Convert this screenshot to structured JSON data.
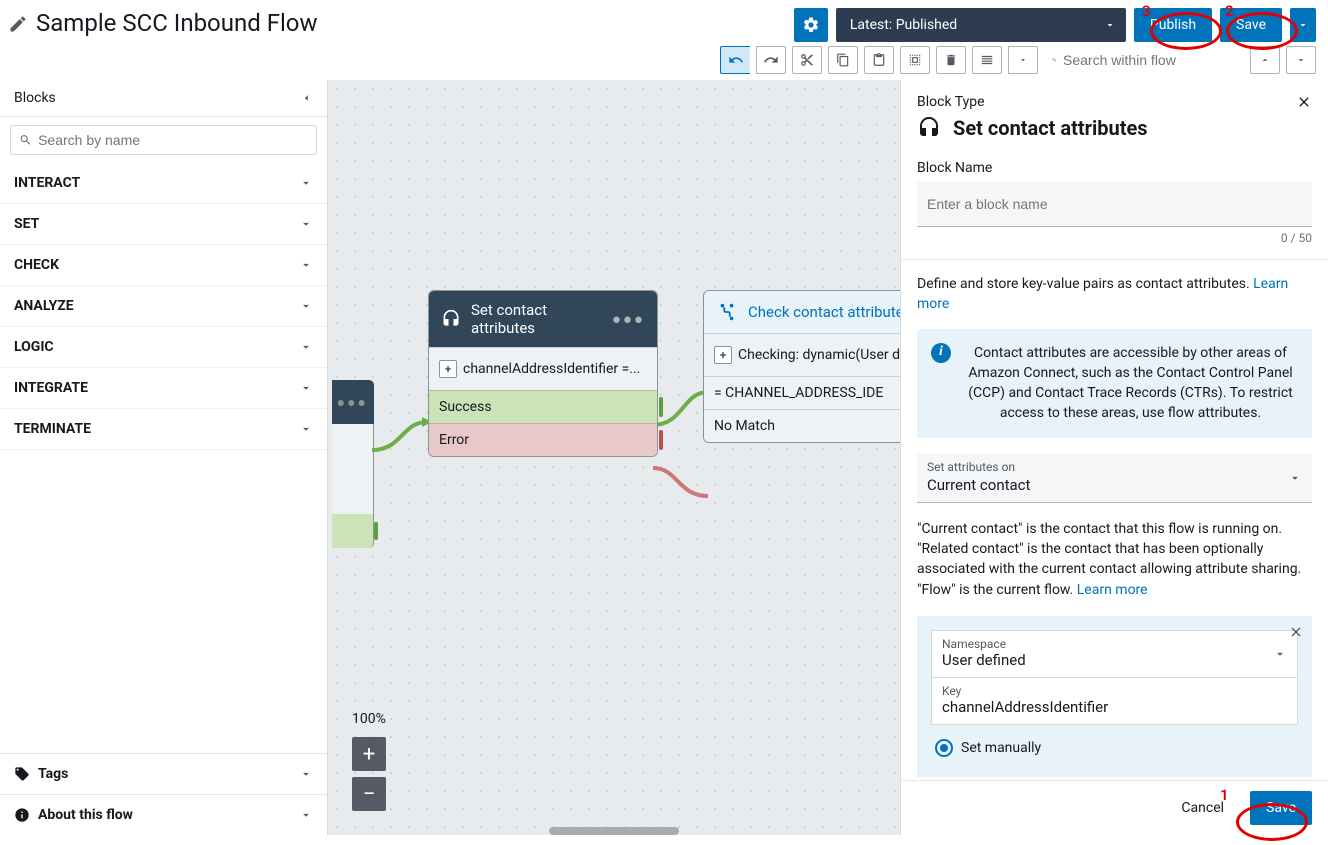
{
  "title": "Sample SCC Inbound Flow",
  "header": {
    "version": "Latest: Published",
    "publish": "Publish",
    "save": "Save",
    "search_placeholder": "Search within flow"
  },
  "sidebar": {
    "title": "Blocks",
    "search_placeholder": "Search by name",
    "categories": [
      "INTERACT",
      "SET",
      "CHECK",
      "ANALYZE",
      "LOGIC",
      "INTEGRATE",
      "TERMINATE"
    ],
    "tags_label": "Tags",
    "about_label": "About this flow"
  },
  "canvas": {
    "zoom": "100%",
    "node_set": {
      "title": "Set contact attributes",
      "detail": "channelAddressIdentifier =...",
      "success": "Success",
      "error": "Error"
    },
    "node_check": {
      "title": "Check contact attributes",
      "detail": "Checking: dynamic(User d..",
      "branch1": "= CHANNEL_ADDRESS_IDE",
      "nomatch": "No Match"
    }
  },
  "panel": {
    "block_type_label": "Block Type",
    "title": "Set contact attributes",
    "block_name_label": "Block Name",
    "block_name_placeholder": "Enter a block name",
    "counter": "0 / 50",
    "desc": "Define and store key-value pairs as contact attributes. ",
    "learn_more": "Learn more",
    "info": "Contact attributes are accessible by other areas of Amazon Connect, such as the Contact Control Panel (CCP) and Contact Trace Records (CTRs). To restrict access to these areas, use flow attributes.",
    "set_on_label": "Set attributes on",
    "set_on_value": "Current contact",
    "context": "\"Current contact\" is the contact that this flow is running on. \"Related contact\" is the contact that has been optionally associated with the current contact allowing attribute sharing. \"Flow\" is the current flow. ",
    "ns_label": "Namespace",
    "ns_value": "User defined",
    "key_label": "Key",
    "key_value": "channelAddressIdentifier",
    "set_manually": "Set manually",
    "cancel": "Cancel",
    "save": "Save"
  },
  "annotations": {
    "n1": "1",
    "n2": "2",
    "n3": "3"
  }
}
